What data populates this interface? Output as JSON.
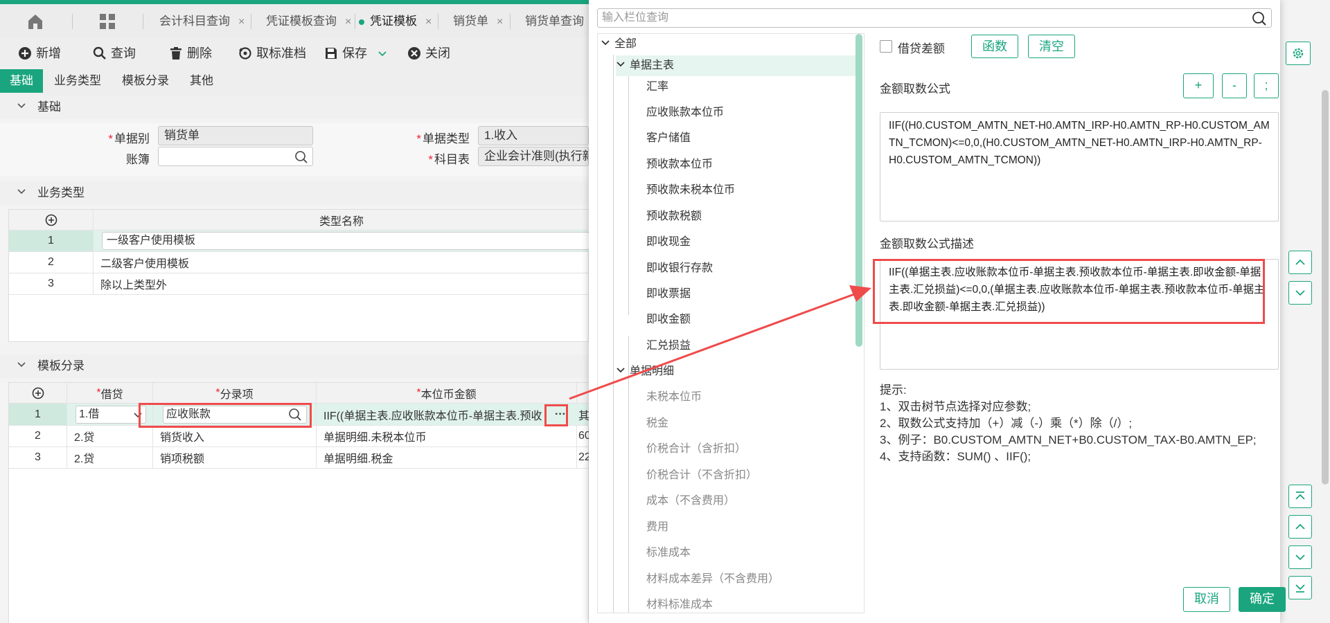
{
  "top_tabs": [
    {
      "label": "会计科目查询",
      "active": false
    },
    {
      "label": "凭证模板查询",
      "active": false
    },
    {
      "label": "凭证模板",
      "active": true
    },
    {
      "label": "销货单",
      "active": false
    },
    {
      "label": "销货单查询",
      "active": false
    }
  ],
  "close_glyph": "×",
  "toolbar": {
    "add": "新增",
    "query": "查询",
    "delete": "删除",
    "cancel_standard": "取标准档",
    "save": "保存",
    "close": "关闭"
  },
  "sub_tabs": [
    {
      "label": "基础",
      "active": true
    },
    {
      "label": "业务类型",
      "active": false
    },
    {
      "label": "模板分录",
      "active": false
    },
    {
      "label": "其他",
      "active": false
    }
  ],
  "basic": {
    "section_title": "基础",
    "doc_type_label": "单据别",
    "doc_type_value": "销货单",
    "ledger_label": "账簿",
    "ledger_value": "",
    "doc_kind_label": "单据类型",
    "doc_kind_value": "1.收入",
    "account_table_label": "科目表",
    "account_table_value": "企业会计准则(执行新"
  },
  "biz_types": {
    "section_title": "业务类型",
    "col_name": "类型名称",
    "rows": [
      {
        "no": "1",
        "name": "一级客户使用模板"
      },
      {
        "no": "2",
        "name": "二级客户使用模板"
      },
      {
        "no": "3",
        "name": "除以上类型外"
      }
    ]
  },
  "entries": {
    "section_title": "模板分录",
    "col_dc": "借贷",
    "col_item": "分录项",
    "col_amount": "本位币金额",
    "rows": [
      {
        "no": "1",
        "dc": "1.借",
        "item": "应收账款",
        "amount": "IIF((单据主表.应收账款本位币-单据主表.预收",
        "extra": "其"
      },
      {
        "no": "2",
        "dc": "2.贷",
        "item": "销货收入",
        "amount": "单据明细.未税本位币",
        "extra": "60"
      },
      {
        "no": "3",
        "dc": "2.贷",
        "item": "销项税额",
        "amount": "单据明细.税金",
        "extra": "22"
      }
    ],
    "more_glyph": "···"
  },
  "modal": {
    "search_placeholder": "输入栏位查询",
    "tree": {
      "root": "全部",
      "main_table": "单据主表",
      "main_fields": [
        "汇率",
        "应收账款本位币",
        "客户储值",
        "预收款本位币",
        "预收款未税本位币",
        "预收款税额",
        "即收现金",
        "即收银行存款",
        "即收票据",
        "即收金额",
        "汇兑损益"
      ],
      "detail_table": "单据明细",
      "detail_fields": [
        "未税本位币",
        "税金",
        "价税合计（含折扣）",
        "价税合计（不含折扣）",
        "成本（不含费用）",
        "费用",
        "标准成本",
        "材料成本差异（不含费用）",
        "材料标准成本"
      ]
    },
    "dc_diff_label": "借贷差额",
    "func_btn": "函数",
    "clear_btn": "清空",
    "formula_label": "金额取数公式",
    "op_plus": "+",
    "op_minus": "-",
    "op_semicolon": ";",
    "formula_value": "IIF((H0.CUSTOM_AMTN_NET-H0.AMTN_IRP-H0.AMTN_RP-H0.CUSTOM_AMTN_TCMON)<=0,0,(H0.CUSTOM_AMTN_NET-H0.AMTN_IRP-H0.AMTN_RP-H0.CUSTOM_AMTN_TCMON))",
    "desc_label": "金额取数公式描述",
    "desc_value": "IIF((单据主表.应收账款本位币-单据主表.预收款本位币-单据主表.即收金额-单据主表.汇兑损益)<=0,0,(单据主表.应收账款本位币-单据主表.预收款本位币-单据主表.即收金额-单据主表.汇兑损益))",
    "tips_title": "提示:",
    "tips": [
      "1、双击树节点选择对应参数;",
      "2、取数公式支持加（+）减（-）乘（*）除（/）;",
      "3、例子：B0.CUSTOM_AMTN_NET+B0.CUSTOM_TAX-B0.AMTN_EP;",
      "4、支持函数：SUM() 、IIF();"
    ],
    "cancel_btn": "取消",
    "ok_btn": "确定"
  },
  "colors": {
    "accent": "#1aa57e",
    "annotation": "#ef4b4b"
  },
  "icons": [
    "home-icon",
    "apps-grid-icon",
    "plus-circle-icon",
    "search-icon",
    "trash-icon",
    "undo-icon",
    "save-icon",
    "close-circle-icon",
    "gear-icon",
    "chevron-down-icon",
    "arrow-annotation"
  ]
}
